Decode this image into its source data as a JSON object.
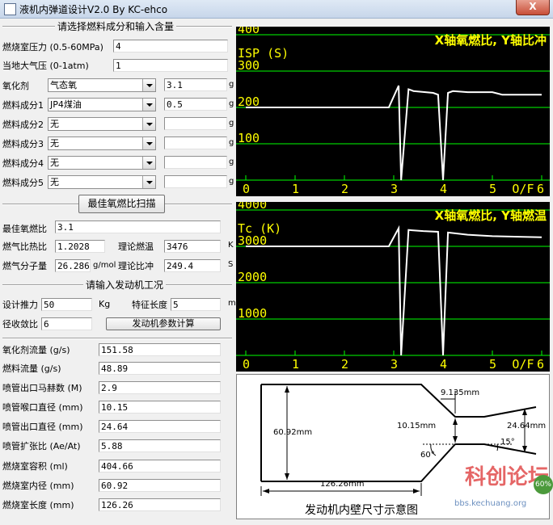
{
  "window": {
    "title": "液机内弹道设计V2.0 By KC-ehco",
    "close": "X"
  },
  "fuel_section": {
    "title": "请选择燃料成分和输入含量",
    "chamber_pressure": {
      "label": "燃烧室压力 (0.5-60MPa)",
      "value": "4"
    },
    "atm_pressure": {
      "label": "当地大气压 (0-1atm)",
      "value": "1"
    },
    "oxidizer": {
      "label": "氧化剂",
      "selected": "气态氧",
      "amount": "3.1",
      "unit": "g"
    },
    "fuels": [
      {
        "label": "燃料成分1",
        "selected": "JP4煤油",
        "amount": "0.5",
        "unit": "g"
      },
      {
        "label": "燃料成分2",
        "selected": "无",
        "amount": "",
        "unit": "g"
      },
      {
        "label": "燃料成分3",
        "selected": "无",
        "amount": "",
        "unit": "g"
      },
      {
        "label": "燃料成分4",
        "selected": "无",
        "amount": "",
        "unit": "g"
      },
      {
        "label": "燃料成分5",
        "selected": "无",
        "amount": "",
        "unit": "g"
      }
    ],
    "scan_button": "最佳氧燃比扫描"
  },
  "results": {
    "best_ratio": {
      "label": "最佳氧燃比",
      "value": "3.1"
    },
    "heat_ratio": {
      "label": "燃气比热比",
      "value": "1.2028"
    },
    "theory_temp": {
      "label": "理论燃温",
      "value": "3476",
      "unit": "K"
    },
    "mol_weight": {
      "label": "燃气分子量",
      "value": "26.286",
      "unit": "g/mol"
    },
    "theory_isp": {
      "label": "理论比冲",
      "value": "249.4",
      "unit": "S"
    }
  },
  "engine_section": {
    "title": "请输入发动机工况",
    "thrust": {
      "label": "设计推力",
      "value": "50",
      "unit": "Kg"
    },
    "char_length": {
      "label": "特征长度",
      "value": "5",
      "unit": "m"
    },
    "contraction": {
      "label": "径收敛比",
      "value": "6"
    },
    "calc_button": "发动机参数计算"
  },
  "outputs": [
    {
      "label": "氧化剂流量 (g/s)",
      "value": "151.58"
    },
    {
      "label": "燃料流量 (g/s)",
      "value": "48.89"
    },
    {
      "label": "喷管出口马赫数 (M)",
      "value": "2.9"
    },
    {
      "label": "喷管喉口直径 (mm)",
      "value": "10.15"
    },
    {
      "label": "喷管出口直径 (mm)",
      "value": "24.64"
    },
    {
      "label": "喷管扩张比 (Ae/At)",
      "value": "5.88"
    },
    {
      "label": "燃烧室容积 (ml)",
      "value": "404.66"
    },
    {
      "label": "燃烧室内径 (mm)",
      "value": "60.92"
    },
    {
      "label": "燃烧室长度 (mm)",
      "value": "126.26"
    }
  ],
  "chart_data": [
    {
      "type": "line",
      "title": "X轴氧燃比, Y轴比冲",
      "ylabel": "ISP (S)",
      "xlabel": "O/F",
      "xlim": [
        0,
        6
      ],
      "ylim": [
        0,
        400
      ],
      "xticks": [
        "0",
        "1",
        "2",
        "3",
        "4",
        "5",
        "6"
      ],
      "yticks": [
        "100",
        "200",
        "300",
        "400"
      ],
      "series": [
        {
          "x": [
            0,
            2.9,
            3.1,
            3.15,
            3.3,
            3.4,
            3.8,
            3.9,
            4.0,
            4.1,
            4.2,
            4.5,
            5.0,
            5.2,
            6.0
          ],
          "y": [
            200,
            200,
            260,
            0,
            250,
            245,
            240,
            235,
            0,
            240,
            245,
            242,
            242,
            235,
            235
          ]
        }
      ],
      "colors": {
        "line": "#ffffff",
        "text": "#ffff00",
        "grid": "#00ff00",
        "bg": "#000000"
      }
    },
    {
      "type": "line",
      "title": "X轴氧燃比, Y轴燃温",
      "ylabel": "Tc (K)",
      "xlabel": "O/F",
      "xlim": [
        0,
        6
      ],
      "ylim": [
        0,
        4000
      ],
      "xticks": [
        "0",
        "1",
        "2",
        "3",
        "4",
        "5",
        "6"
      ],
      "yticks": [
        "1000",
        "2000",
        "3000",
        "4000"
      ],
      "series": [
        {
          "x": [
            0,
            2.9,
            3.1,
            3.15,
            3.3,
            3.6,
            3.9,
            4.0,
            4.1,
            4.5,
            5.0,
            6.0
          ],
          "y": [
            3000,
            3000,
            3500,
            0,
            3450,
            3420,
            3400,
            0,
            3380,
            3320,
            3280,
            3250
          ]
        }
      ],
      "colors": {
        "line": "#ffffff",
        "text": "#ffff00",
        "grid": "#00ff00",
        "bg": "#000000"
      }
    }
  ],
  "diagram": {
    "caption": "发动机内壁尺寸示意图",
    "chamber_diameter": "60.92mm",
    "chamber_length": "126.26mm",
    "throat_length": "9.135mm",
    "throat_diameter": "10.15mm",
    "exit_diameter": "24.64mm",
    "converge_angle": "60°",
    "diverge_angle": "15°"
  },
  "watermark": {
    "text": "科创论坛",
    "site": "bbs.kechuang.org",
    "percent": "60%"
  }
}
